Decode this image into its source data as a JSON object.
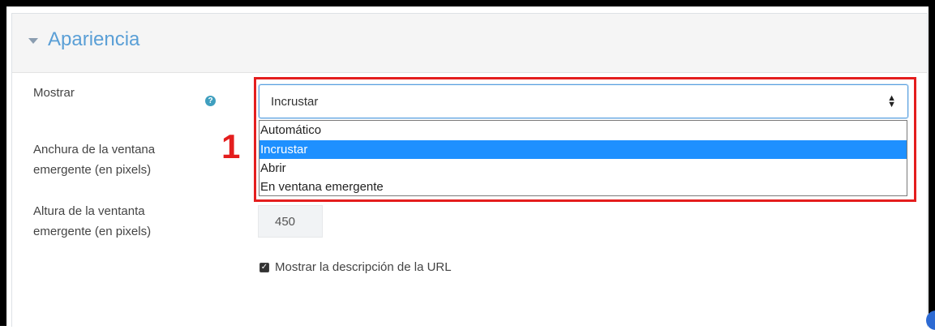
{
  "section": {
    "title": "Apariencia"
  },
  "fields": {
    "mostrar_label": "Mostrar",
    "anchura_label_line1": "Anchura de la ventana",
    "anchura_label_line2": "emergente (en pixels)",
    "altura_label_line1": "Altura de la ventanta",
    "altura_label_line2": "emergente (en pixels)",
    "altura_value": "450"
  },
  "select": {
    "value": "Incrustar",
    "options": [
      "Automático",
      "Incrustar",
      "Abrir",
      "En ventana emergente"
    ],
    "selected_index": 1
  },
  "annotation": {
    "marker": "1",
    "color": "#e41e1e"
  },
  "checkbox": {
    "label": "Mostrar la descripción de la URL",
    "checked": true
  },
  "colors": {
    "title": "#5a9fd6",
    "selected_option_bg": "#1e90ff",
    "help_icon": "#3f9fbf"
  }
}
